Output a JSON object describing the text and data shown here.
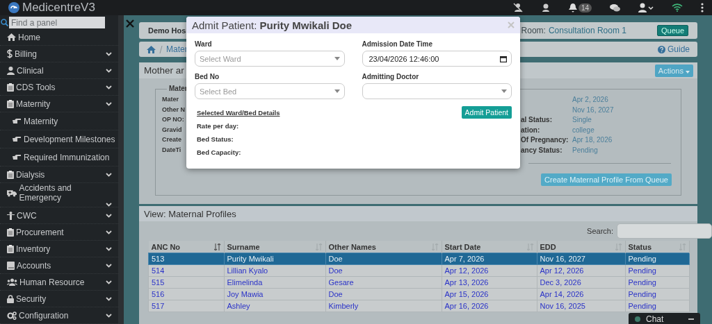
{
  "topbar": {
    "logo_text": "MedicentreV3",
    "notification_count": "14"
  },
  "sidebar": {
    "search": {
      "placeholder": "Find a panel"
    },
    "items": [
      {
        "label": "Home",
        "kind": "link"
      },
      {
        "label": "Billing",
        "kind": "menu"
      },
      {
        "label": "Clinical",
        "kind": "menu"
      },
      {
        "label": "CDS Tools",
        "kind": "menu"
      },
      {
        "label": "Maternity",
        "kind": "menu",
        "children": [
          {
            "label": "Maternity"
          },
          {
            "label": "Development Milestones"
          },
          {
            "label": "Required Immunization"
          }
        ]
      },
      {
        "label": "Dialysis",
        "kind": "menu"
      },
      {
        "label": "Accidents and Emergency",
        "kind": "menu"
      },
      {
        "label": "CWC",
        "kind": "menu"
      },
      {
        "label": "Procurement",
        "kind": "menu"
      },
      {
        "label": "Inventory",
        "kind": "menu"
      },
      {
        "label": "Accounts",
        "kind": "menu"
      },
      {
        "label": "Human Resource",
        "kind": "menu"
      },
      {
        "label": "Security",
        "kind": "menu"
      },
      {
        "label": "Configuration",
        "kind": "menu"
      }
    ]
  },
  "header": {
    "hospital": "Demo Hos",
    "room_label": "Room:",
    "room": "Consultation Room 1",
    "queue_button": "Queue"
  },
  "breadcrumb": {
    "current": "Mater",
    "guide": "Guide"
  },
  "mother_panel": {
    "title": "Mother ar",
    "actions_button": "Actions",
    "legend": "Mater",
    "rows": [
      {
        "left": "Mater",
        "value": "Apr 2, 2026"
      },
      {
        "left": "Other N",
        "value": "Nov 16, 2027"
      },
      {
        "left": "OP NO:",
        "label": "al Status:",
        "value": "Single"
      },
      {
        "left": "Gravid",
        "label": "ation:",
        "value": "college"
      },
      {
        "left": "Create",
        "label": "Of Pregnancy:",
        "value": "Apr 18, 2026"
      },
      {
        "left": "DateTi",
        "label": "ancy Status:",
        "value": "Pending"
      }
    ],
    "create_button": "Create Maternal Profile From Queue"
  },
  "profiles": {
    "title": "View: Maternal Profiles",
    "search_label": "Search:",
    "columns": [
      "ANC No",
      "Surname",
      "Other Names",
      "Start Date",
      "EDD",
      "Status"
    ],
    "rows": [
      {
        "selected": true,
        "cells": [
          "513",
          "Purity Mwikali",
          "Doe",
          "Apr 7, 2026",
          "Nov 16, 2027",
          "Pending"
        ]
      },
      {
        "selected": false,
        "cells": [
          "514",
          "Lillian Kyalo",
          "Doe",
          "Apr 12, 2026",
          "Apr 12, 2026",
          "Pending"
        ]
      },
      {
        "selected": false,
        "cells": [
          "515",
          "Elimelinda",
          "Gesare",
          "Apr 13, 2026",
          "Dec 3, 2026",
          "Pending"
        ]
      },
      {
        "selected": false,
        "cells": [
          "516",
          "Joy Mawia",
          "Doe",
          "Apr 15, 2026",
          "Apr 14, 2026",
          "Pending"
        ]
      },
      {
        "selected": false,
        "cells": [
          "517",
          "Ashley",
          "Kimberly",
          "Apr 16, 2026",
          "Nov 16, 2025",
          "Pending"
        ]
      }
    ]
  },
  "modal": {
    "title": "Admit Patient: **Purity Mwikali Doe**",
    "ward_label": "Ward",
    "ward_placeholder": "Select Ward",
    "date_label": "Admission Date Time",
    "date_value": "23/04/2026 12:46:00",
    "bed_label": "Bed No",
    "bed_placeholder": "Select Bed",
    "doctor_label": "Admitting Doctor",
    "details_title": "Selected Ward/Bed Details",
    "details": [
      "Rate per day:",
      "Bed Status:",
      "Bed Capacity:"
    ],
    "admit_button": "Admit Patient"
  },
  "chat": {
    "label": "Chat"
  }
}
